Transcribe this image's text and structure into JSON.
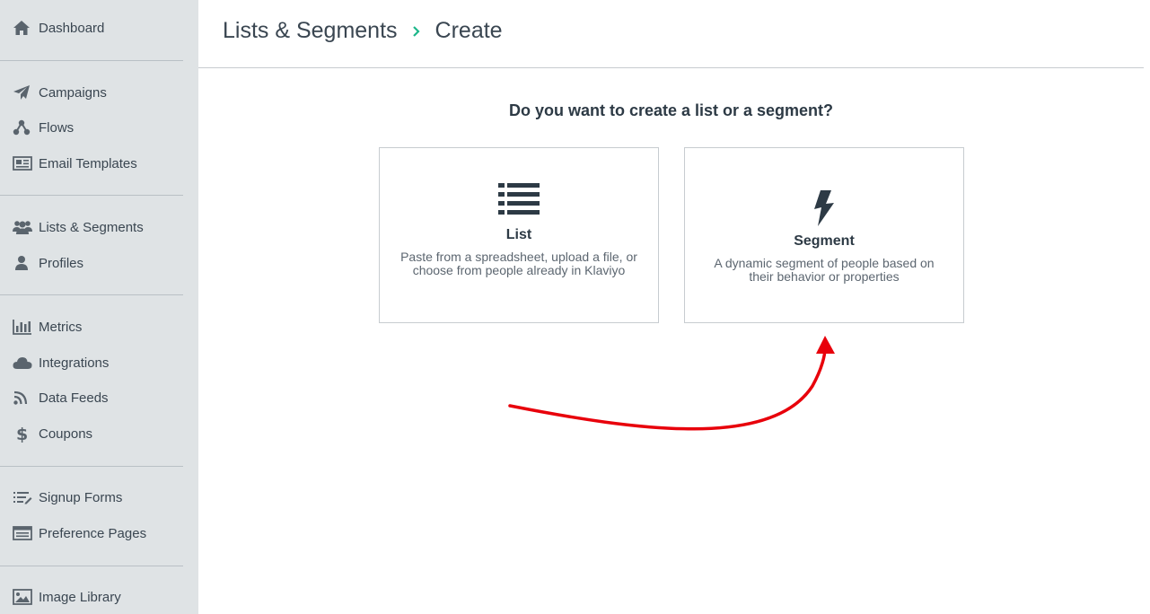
{
  "sidebar": {
    "items": [
      {
        "label": "Dashboard",
        "icon": "home-icon"
      },
      {
        "label": "Campaigns",
        "icon": "paper-plane-icon"
      },
      {
        "label": "Flows",
        "icon": "flow-icon"
      },
      {
        "label": "Email Templates",
        "icon": "newspaper-icon"
      },
      {
        "label": "Lists & Segments",
        "icon": "users-icon"
      },
      {
        "label": "Profiles",
        "icon": "user-icon"
      },
      {
        "label": "Metrics",
        "icon": "bar-chart-icon"
      },
      {
        "label": "Integrations",
        "icon": "cloud-icon"
      },
      {
        "label": "Data Feeds",
        "icon": "rss-icon"
      },
      {
        "label": "Coupons",
        "icon": "dollar-icon"
      },
      {
        "label": "Signup Forms",
        "icon": "form-list-icon"
      },
      {
        "label": "Preference Pages",
        "icon": "browser-window-icon"
      },
      {
        "label": "Image Library",
        "icon": "image-icon"
      }
    ]
  },
  "header": {
    "breadcrumb_parent": "Lists & Segments",
    "breadcrumb_current": "Create"
  },
  "main": {
    "question": "Do you want to create a list or a segment?",
    "cards": [
      {
        "title": "List",
        "description": "Paste from a spreadsheet, upload a file, or choose from people already in Klaviyo",
        "icon": "list-icon"
      },
      {
        "title": "Segment",
        "description": "A dynamic segment of people based on their behavior or properties",
        "icon": "lightning-bolt-icon"
      }
    ]
  },
  "annotation": {
    "color": "#e8000b"
  },
  "colors": {
    "sidebar_bg": "#dfe3e5",
    "accent": "#1db78a",
    "text": "#2d3a45"
  }
}
